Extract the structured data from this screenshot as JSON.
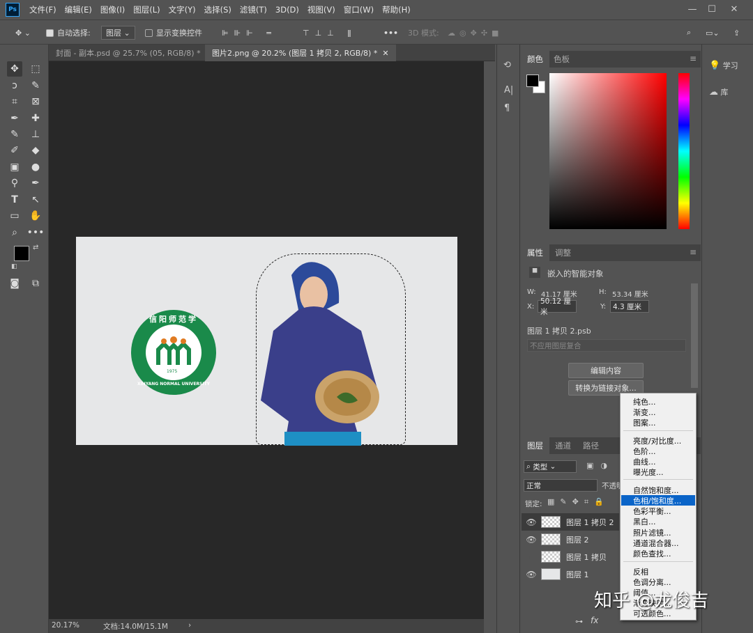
{
  "app": {
    "logo": "Ps"
  },
  "menu": [
    "文件(F)",
    "编辑(E)",
    "图像(I)",
    "图层(L)",
    "文字(Y)",
    "选择(S)",
    "滤镜(T)",
    "3D(D)",
    "视图(V)",
    "窗口(W)",
    "帮助(H)"
  ],
  "window_controls": {
    "min": "—",
    "max": "☐",
    "close": "✕"
  },
  "options": {
    "auto_select_label": "自动选择:",
    "auto_select_target": "图层",
    "show_transform_label": "显示变换控件",
    "mode_3d_label": "3D 模式:",
    "more": "•••"
  },
  "tabs": [
    {
      "label": "封面 - 副本.psd @ 25.7% (05, RGB/8) *",
      "close": "✕"
    },
    {
      "label": "图片2.png @ 20.2% (图层 1 拷贝 2, RGB/8) *",
      "close": "✕"
    }
  ],
  "document": {
    "logo_text_top": "信阳师范学院",
    "logo_text_bottom": "XINYANG NORMAL UNIVERSITY",
    "logo_year": "1975",
    "brand_color": "#1a8a4a"
  },
  "status": {
    "zoom": "20.17%",
    "doc_info": "文档:14.0M/15.1M",
    "arrow": "›"
  },
  "color_panel": {
    "tabs": [
      "颜色",
      "色板"
    ],
    "foreground": "#000000",
    "background": "#ffffff"
  },
  "properties_panel": {
    "tabs": [
      "属性",
      "调整"
    ],
    "header": "嵌入的智能对象",
    "w_label": "W:",
    "w_value": "41.17 厘米",
    "h_label": "H:",
    "h_value": "53.34 厘米",
    "x_label": "X:",
    "x_value": "50.12 厘米",
    "y_label": "Y:",
    "y_value": "4.3 厘米",
    "source": "图层 1 拷贝 2.psb",
    "comp_placeholder": "不应用图层复合",
    "edit_button": "编辑内容",
    "convert_button": "转换为链接对象..."
  },
  "layers_panel": {
    "tabs": [
      "图层",
      "通道",
      "路径"
    ],
    "filter_label": "类型",
    "blend_mode": "正常",
    "opacity_label": "不透明度:",
    "lock_label": "锁定:",
    "layers": [
      {
        "name": "图层 1 拷贝 2",
        "visible": true
      },
      {
        "name": "图层 2",
        "visible": true
      },
      {
        "name": "图层 1 拷贝",
        "visible": false
      },
      {
        "name": "图层 1",
        "visible": true
      }
    ],
    "bottom_icons": [
      "link",
      "fx"
    ]
  },
  "context_menu": {
    "group1": [
      "纯色...",
      "渐变...",
      "图案..."
    ],
    "group2": [
      "亮度/对比度...",
      "色阶...",
      "曲线...",
      "曝光度..."
    ],
    "group3": [
      "自然饱和度...",
      "色相/饱和度...",
      "色彩平衡...",
      "黑白...",
      "照片滤镜...",
      "通道混合器...",
      "颜色查找..."
    ],
    "group4": [
      "反相",
      "色调分离...",
      "阈值...",
      "渐变映射...",
      "可选颜色..."
    ],
    "highlighted": "色相/饱和度..."
  },
  "right_panel": {
    "learn": "学习",
    "library": "库"
  },
  "watermark": "知乎 @龙俊吉"
}
